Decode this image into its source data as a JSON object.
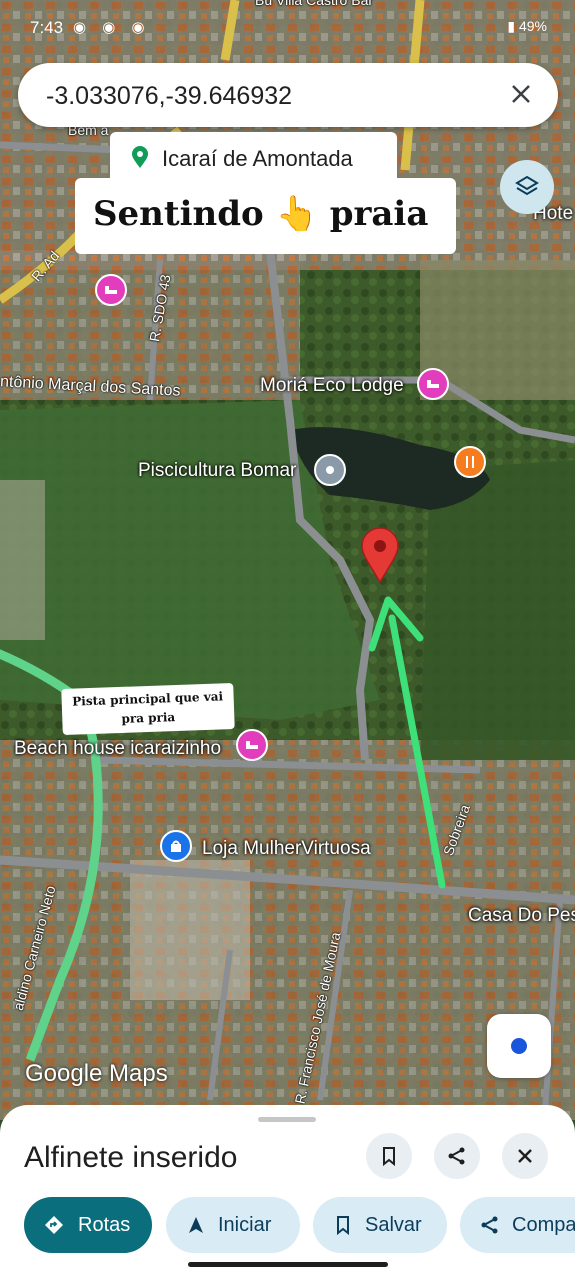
{
  "status_bar": {
    "time": "7:43",
    "battery": "49%"
  },
  "search": {
    "query": "-3.033076,-39.646932"
  },
  "place_chip": {
    "label": "Icaraí de Amontada"
  },
  "overlay_text": {
    "banner": "Sentindo 👆 praia",
    "note": "Pista principal que vai pra pria"
  },
  "map_labels": {
    "top_partial": "Bem a",
    "poi_moria": "Moriá Eco Lodge",
    "poi_piscicultura": "Piscicultura Bomar",
    "poi_beach_house": "Beach house icaraizinho",
    "poi_loja": "Loja MulherVirtuosa",
    "poi_casa": "Casa Do Pes",
    "poi_hotel": "Hote",
    "street_marcal": "ntônio Marçal dos Santos",
    "street_sdo": "R. SDO 43",
    "street_ad": "R. Ad",
    "street_sobreira": "Sobreira",
    "street_carneiro": "aldino Carneiro Neto",
    "street_francisco": "R. Francisco José de Moura",
    "top_road": "Bu Villa Castro Bar"
  },
  "watermark": "Google Maps",
  "bottom_sheet": {
    "title": "Alfinete inserido",
    "actions": [
      "Rotas",
      "Iniciar",
      "Salvar",
      "Compa"
    ]
  },
  "colors": {
    "primary": "#0b6e7c",
    "pill": "#d9ebf5",
    "pin": "#e53935",
    "arrow": "#3ee07a",
    "road_highlight": "#5fd38a"
  }
}
